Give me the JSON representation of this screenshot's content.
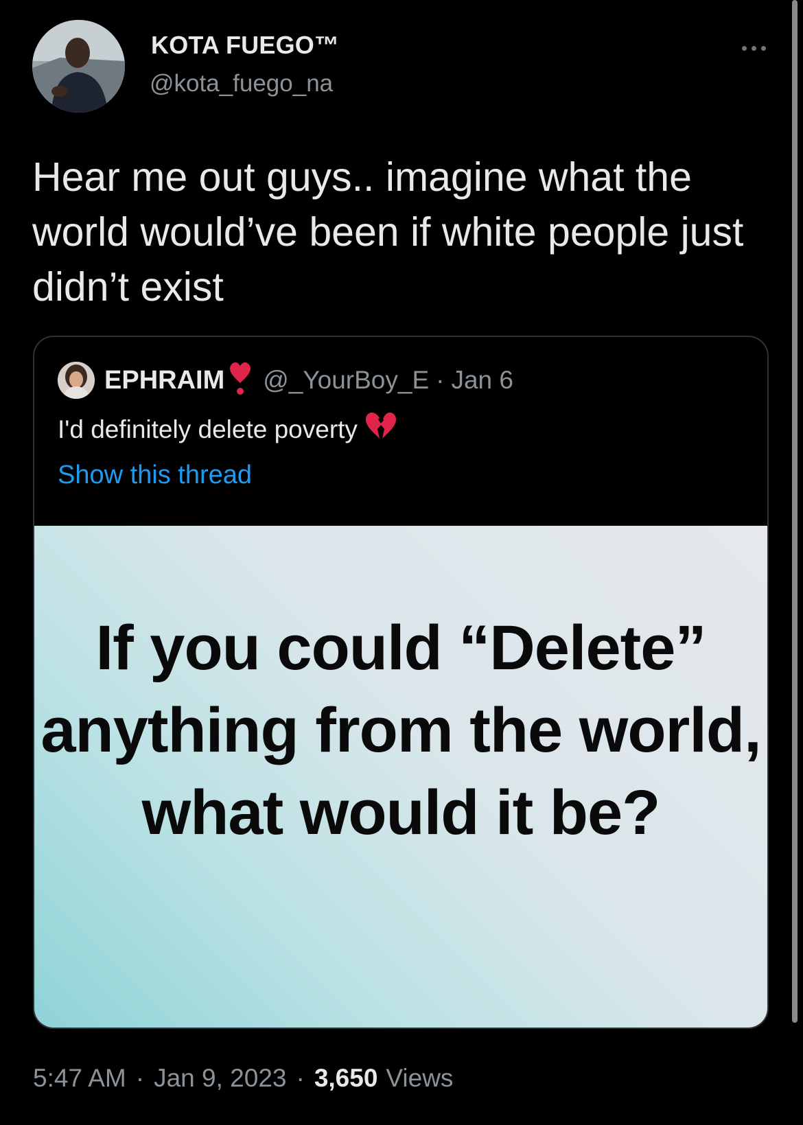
{
  "author": {
    "display_name": "KOTA FUEGO™",
    "handle": "@kota_fuego_na"
  },
  "more_icon": "more-horizontal-icon",
  "tweet": {
    "text": "Hear me out guys.. imagine what the world would’ve been if white people just didn’t exist"
  },
  "quoted_tweet": {
    "author_name": "EPHRAIM",
    "name_badge_icon": "heart-exclamation-icon",
    "handle": "@_YourBoy_E",
    "separator": "·",
    "date": "Jan 6",
    "text": "I'd definitely delete poverty",
    "text_emoji_icon": "broken-heart-icon",
    "show_thread_label": "Show this thread",
    "image_text": "If you could “Delete” anything from the world, what would it be?"
  },
  "footer": {
    "time": "5:47 AM",
    "separator_1": "·",
    "date": "Jan 9, 2023",
    "separator_2": "·",
    "views_count": "3,650",
    "views_label": "Views"
  },
  "colors": {
    "background": "#000000",
    "link": "#1d9bf0",
    "secondary_text": "#8b9399",
    "heart_red": "#e1244a"
  }
}
